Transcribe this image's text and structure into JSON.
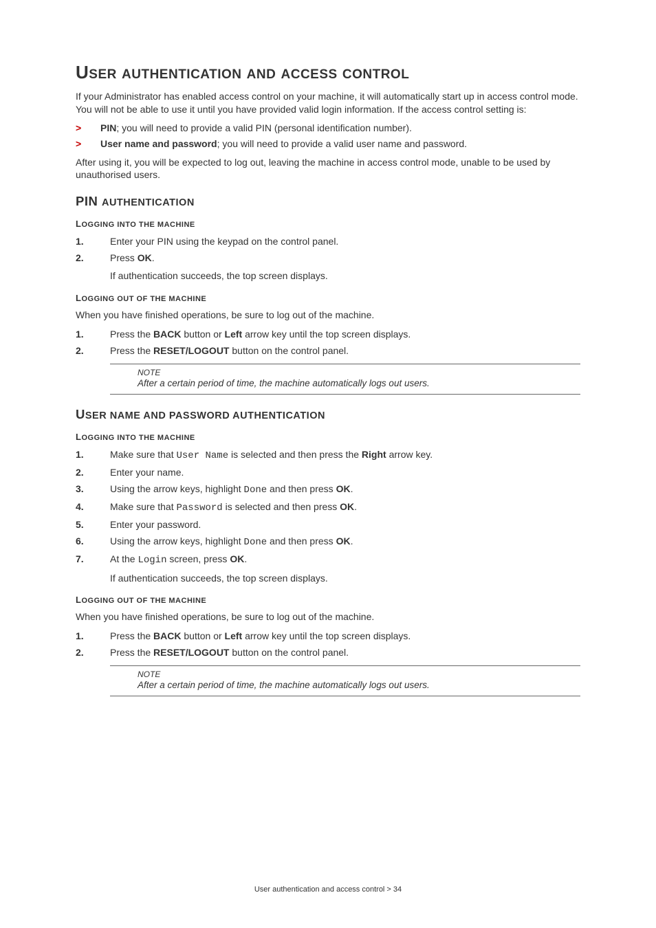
{
  "title": "USER AUTHENTICATION AND ACCESS CONTROL",
  "intro": "If your Administrator has enabled access control on your machine, it will automatically start up in access control mode. You will not be able to use it until you have provided valid login information. If the access control setting is:",
  "bullets": {
    "pin_label": "PIN",
    "pin_text": "; you will need to provide a valid PIN (personal identification number).",
    "up_label": "User name and password",
    "up_text": "; you will need to provide a valid user name and password."
  },
  "after_intro": "After using it, you will be expected to log out, leaving the machine in access control mode, unable to be used by unauthorised users.",
  "pin_section": "PIN AUTHENTICATION",
  "login_heading": "LOGGING INTO THE MACHINE",
  "logout_heading": "LOGGING OUT OF THE MACHINE",
  "pin_login_1": "Enter your PIN using the keypad on the control panel.",
  "pin_login_2a": "Press ",
  "ok": "OK",
  "period": ".",
  "auth_success": "If authentication succeeds, the top screen displays.",
  "logout_intro": "When you have finished operations, be sure to log out of the machine.",
  "logout_1a": "Press the ",
  "back": "BACK",
  "logout_1b": " button or ",
  "left": "Left",
  "logout_1c": " arrow key until the top screen displays.",
  "logout_2a": "Press the ",
  "resetlogout": "RESET/LOGOUT",
  "logout_2b": " button on the control panel.",
  "note_label": "NOTE",
  "note_text": "After a certain period of time, the machine automatically logs out users.",
  "userpw_section": "USER NAME AND PASSWORD AUTHENTICATION",
  "up1a": "Make sure that ",
  "up1_username": "User Name",
  "up1b": " is selected and then press the ",
  "right": "Right",
  "up1c": " arrow key.",
  "up2": "Enter your name.",
  "up3a": "Using the arrow keys, highlight ",
  "done": "Done",
  "up3b": " and then press ",
  "up4a": "Make sure that ",
  "password_mono": "Password",
  "up4b": " is selected and then press ",
  "up5": "Enter your password.",
  "up7a": "At the ",
  "login_mono": "Login",
  "up7b": " screen, press ",
  "footer": "User authentication and access control > 34"
}
